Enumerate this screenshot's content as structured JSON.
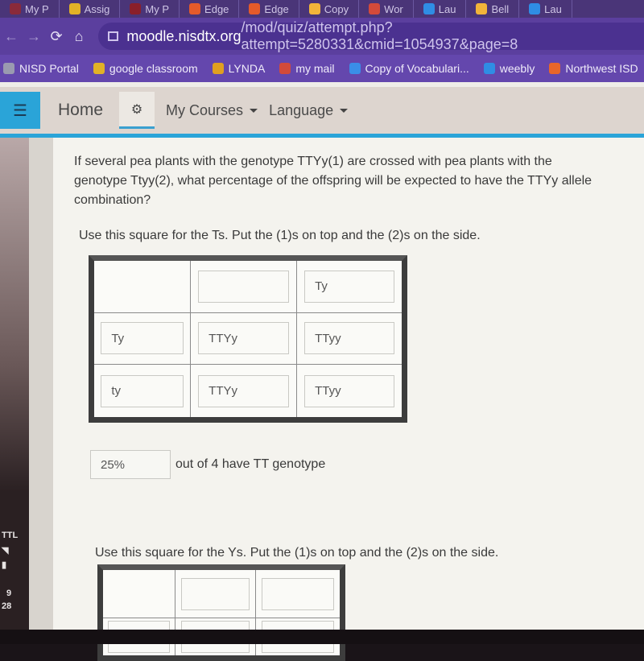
{
  "browser": {
    "tabs": [
      {
        "label": "My P",
        "color": "#8a2a3a"
      },
      {
        "label": "Assig",
        "color": "#e2b227"
      },
      {
        "label": "My P",
        "color": "#8a1f2a"
      },
      {
        "label": "Edge",
        "color": "#e45a2a"
      },
      {
        "label": "Edge",
        "color": "#e45a2a"
      },
      {
        "label": "Copy",
        "color": "#f2b43a"
      },
      {
        "label": "Wor",
        "color": "#d34a3a"
      },
      {
        "label": "Lau",
        "color": "#2f8de4"
      },
      {
        "label": "Bell",
        "color": "#f2b43a"
      },
      {
        "label": "Lau",
        "color": "#2f8de4"
      }
    ],
    "url_host": "moodle.nisdtx.org",
    "url_path": "/mod/quiz/attempt.php?attempt=5280331&cmid=1054937&page=8",
    "bookmarks": [
      {
        "label": "NISD Portal",
        "icon": "portal-icon",
        "color": "#9a9ab0"
      },
      {
        "label": "google classroom",
        "icon": "classroom-icon",
        "color": "#e2b227"
      },
      {
        "label": "LYNDA",
        "icon": "lynda-icon",
        "color": "#e0a020"
      },
      {
        "label": "my mail",
        "icon": "gmail-icon",
        "color": "#d34a3a"
      },
      {
        "label": "Copy of Vocabulari...",
        "icon": "docs-icon",
        "color": "#3a8ee8"
      },
      {
        "label": "weebly",
        "icon": "weebly-icon",
        "color": "#2f8de4"
      },
      {
        "label": "Northwest ISD",
        "icon": "nisd-icon",
        "color": "#e8662a"
      }
    ]
  },
  "moodle_nav": {
    "home": "Home",
    "my_courses": "My Courses",
    "language": "Language"
  },
  "question": {
    "text": "If several pea plants with the genotype TTYy(1) are crossed with pea plants with the genotype Ttyy(2), what percentage of the offspring will be expected to have the TTYy allele combination?",
    "instruction_t": "Use this square for the Ts. Put the (1)s on top and the (2)s on the side.",
    "instruction_y": "Use this square for the Ys. Put the (1)s on top and the (2)s on the side."
  },
  "punnett_t": {
    "cells": [
      [
        "",
        "",
        "Ty"
      ],
      [
        "Ty",
        "TTYy",
        "TTyy"
      ],
      [
        "ty",
        "TTYy",
        "TTyy"
      ]
    ]
  },
  "answer": {
    "value": "25%",
    "suffix": "out of 4 have TT genotype"
  },
  "punnett_y": {
    "cells": [
      [
        "",
        "",
        ""
      ],
      [
        "",
        "",
        ""
      ]
    ]
  },
  "taskbar": {
    "label": "TTL",
    "time_top": "9",
    "time_bottom": "28"
  }
}
